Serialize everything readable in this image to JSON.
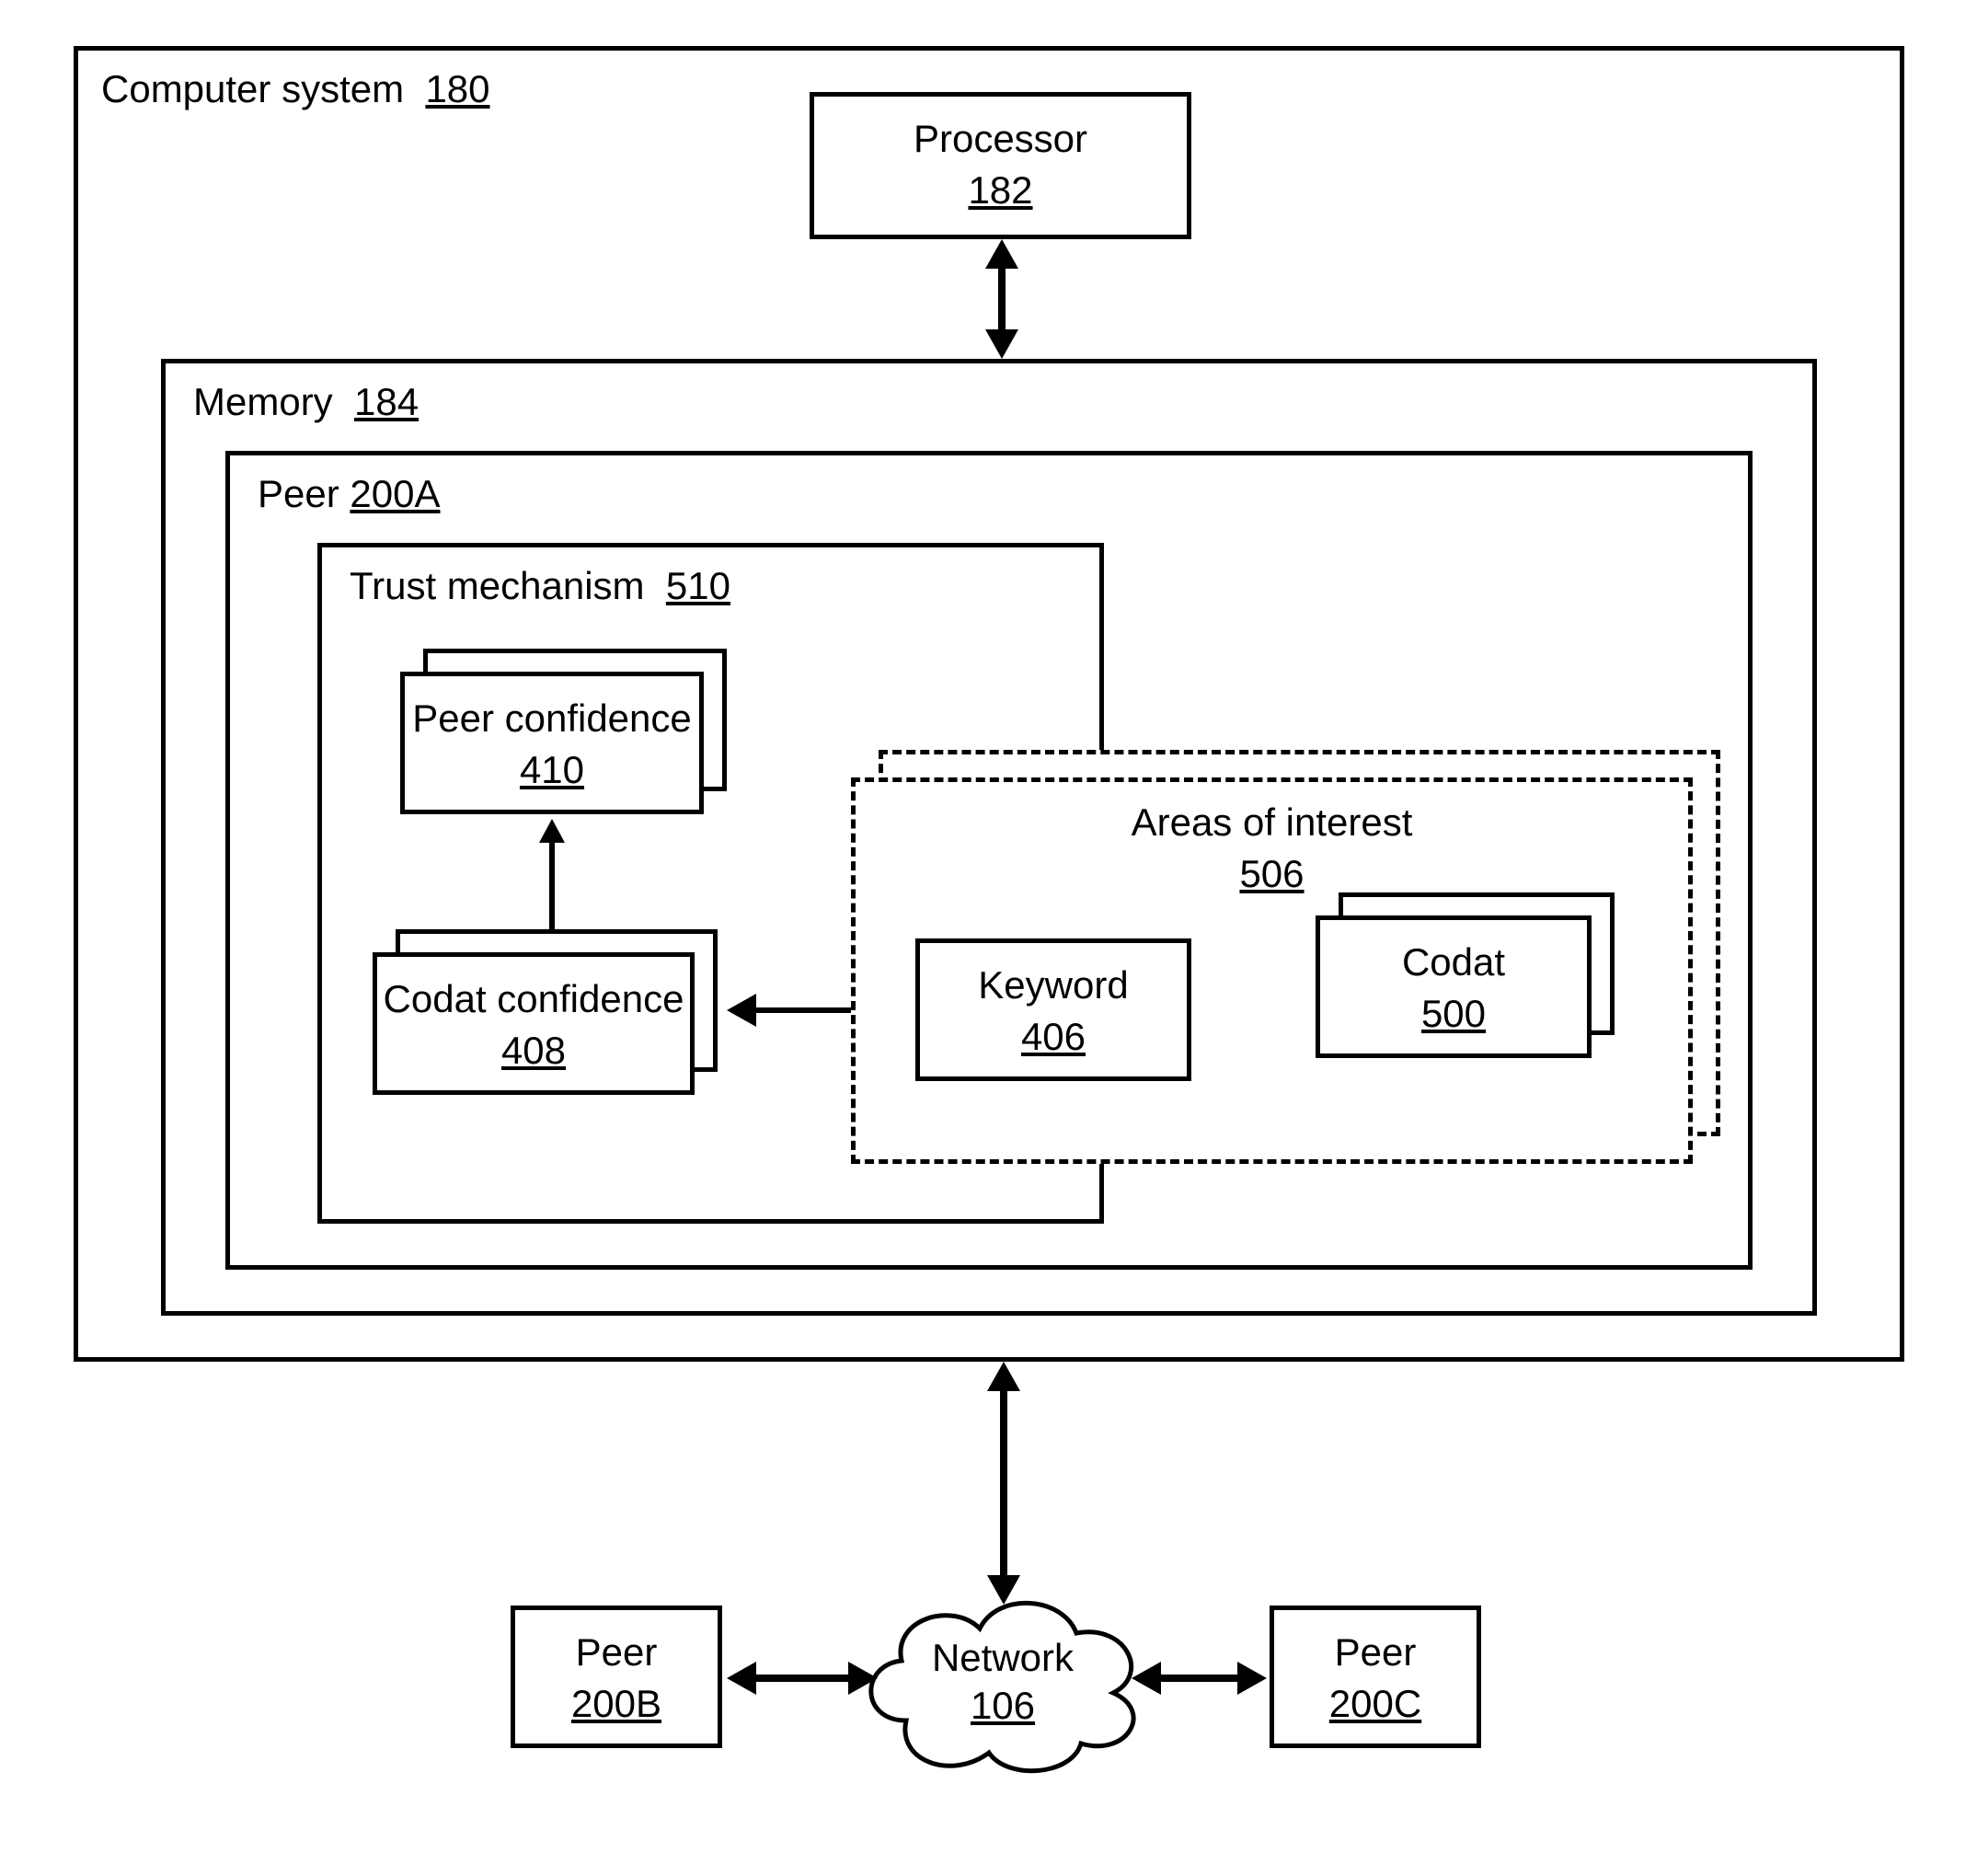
{
  "computerSystem": {
    "name": "Computer system",
    "num": "180"
  },
  "processor": {
    "name": "Processor",
    "num": "182"
  },
  "memory": {
    "name": "Memory",
    "num": "184"
  },
  "peerA": {
    "name": "Peer",
    "num": "200A"
  },
  "trust": {
    "name": "Trust mechanism",
    "num": "510"
  },
  "peerConfidence": {
    "name": "Peer confidence",
    "num": "410"
  },
  "codatConfidence": {
    "name": "Codat confidence",
    "num": "408"
  },
  "areasOfInterest": {
    "name": "Areas of interest",
    "num": "506"
  },
  "keyword": {
    "name": "Keyword",
    "num": "406"
  },
  "codat": {
    "name": "Codat",
    "num": "500"
  },
  "network": {
    "name": "Network",
    "num": "106"
  },
  "peerB": {
    "name": "Peer",
    "num": "200B"
  },
  "peerC": {
    "name": "Peer",
    "num": "200C"
  }
}
